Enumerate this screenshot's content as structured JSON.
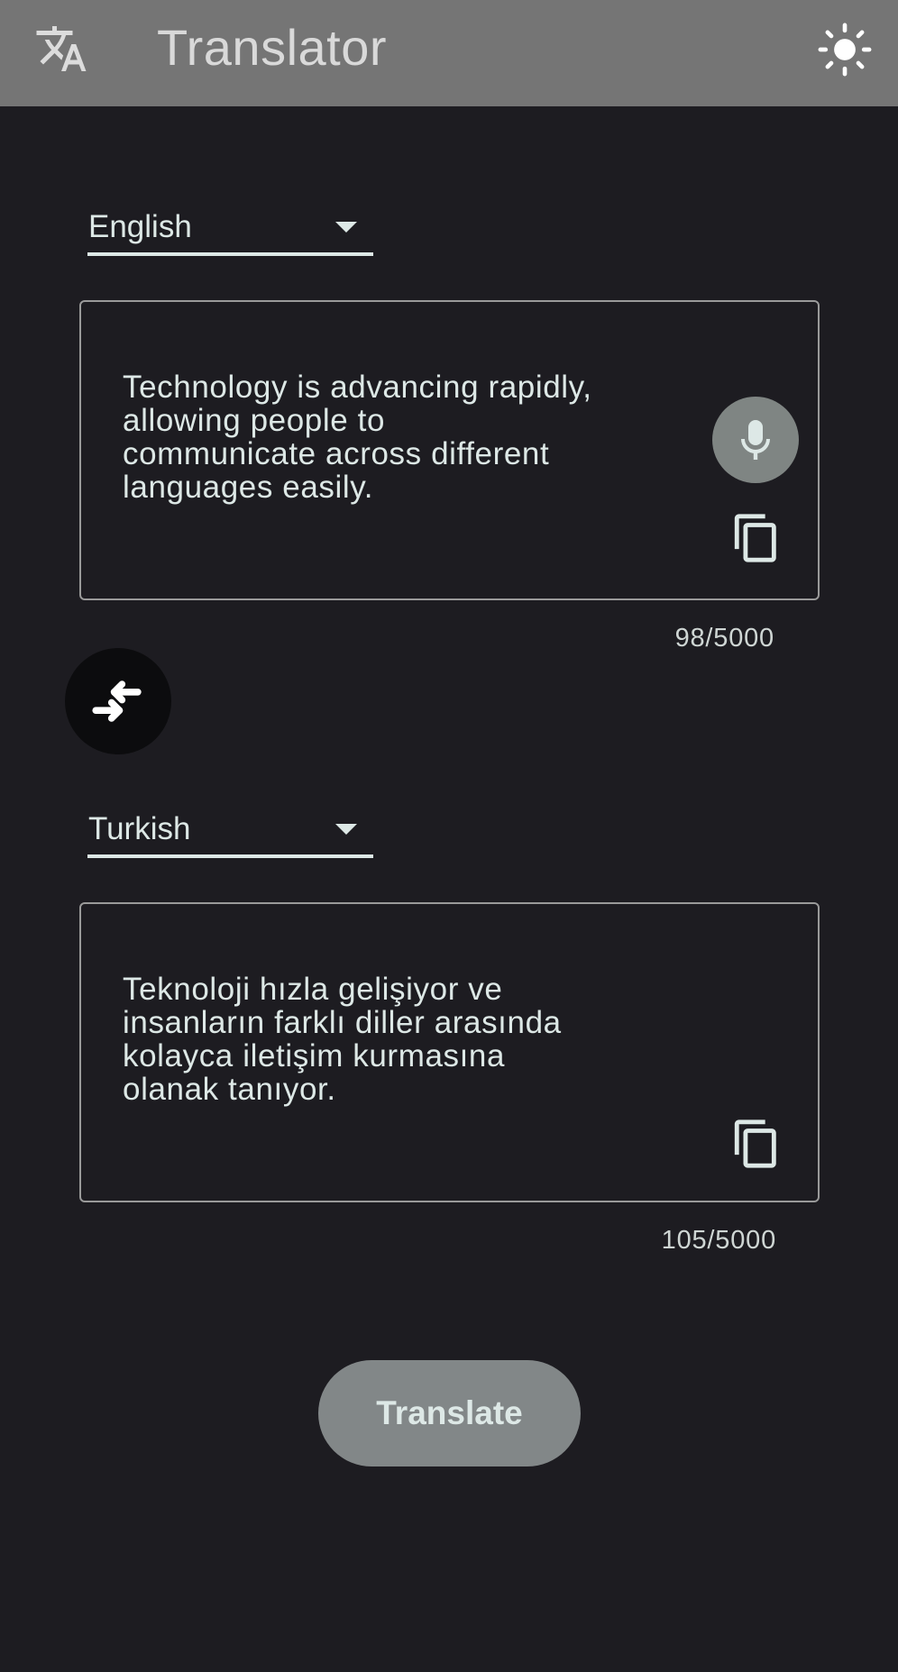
{
  "app_bar": {
    "title": "Translator",
    "leading_icon": "translate-icon",
    "trailing_icon": "brightness-icon",
    "background": "#757575"
  },
  "source": {
    "language": "English",
    "text": "Technology is advancing rapidly,\nallowing people to\ncommunicate across different\nlanguages easily.",
    "char_count": "98/5000",
    "mic_icon": "mic-icon",
    "copy_icon": "copy-icon"
  },
  "swap": {
    "icon": "swap-arrows-icon"
  },
  "target": {
    "language": "Turkish",
    "text": "Teknoloji hızla gelişiyor ve\ninsanların farklı diller arasında\nkolayca iletişim kurmasına\nolanak tanıyor.",
    "char_count": "105/5000",
    "copy_icon": "copy-icon"
  },
  "actions": {
    "translate_label": "Translate"
  },
  "colors": {
    "background": "#1d1c21",
    "accent": "#dde8e6",
    "mic_button": "#7f8583",
    "translate_button": "#828788"
  }
}
